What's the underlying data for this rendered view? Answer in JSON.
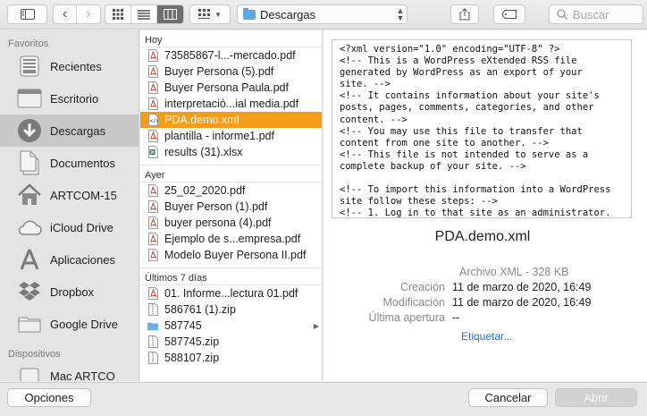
{
  "toolbar": {
    "location": "Descargas",
    "search_placeholder": "Buscar"
  },
  "sidebar": {
    "favorites_header": "Favoritos",
    "items": [
      {
        "label": "Recientes",
        "icon": "recents-icon"
      },
      {
        "label": "Escritorio",
        "icon": "desktop-icon"
      },
      {
        "label": "Descargas",
        "icon": "downloads-icon"
      },
      {
        "label": "Documentos",
        "icon": "documents-icon"
      },
      {
        "label": "ARTCOM-15",
        "icon": "home-icon"
      },
      {
        "label": "iCloud Drive",
        "icon": "cloud-icon"
      },
      {
        "label": "Aplicaciones",
        "icon": "applications-icon"
      },
      {
        "label": "Dropbox",
        "icon": "dropbox-icon"
      },
      {
        "label": "Google Drive",
        "icon": "folder-icon"
      }
    ],
    "devices_header": "Dispositivos",
    "device": "Mac ARTCO"
  },
  "files": {
    "today_header": "Hoy",
    "today": [
      {
        "name": "73585867-l...-mercado.pdf",
        "type": "pdf"
      },
      {
        "name": "Buyer Persona (5).pdf",
        "type": "pdf"
      },
      {
        "name": "Buyer Persona Paula.pdf",
        "type": "pdf"
      },
      {
        "name": "interpretació...ial media.pdf",
        "type": "pdf"
      },
      {
        "name": "PDA.demo.xml",
        "type": "xml"
      },
      {
        "name": "plantilla - informe1.pdf",
        "type": "pdf"
      },
      {
        "name": "results (31).xlsx",
        "type": "xlsx"
      }
    ],
    "yesterday_header": "Ayer",
    "yesterday": [
      {
        "name": "25_02_2020.pdf",
        "type": "pdf"
      },
      {
        "name": "Buyer Person (1).pdf",
        "type": "pdf"
      },
      {
        "name": "buyer persona (4).pdf",
        "type": "pdf"
      },
      {
        "name": "Ejemplo de s...empresa.pdf",
        "type": "pdf"
      },
      {
        "name": "Modelo Buyer Persona II.pdf",
        "type": "pdf"
      }
    ],
    "week_header": "Últimos 7 días",
    "week": [
      {
        "name": "01. Informe...lectura 01.pdf",
        "type": "pdf"
      },
      {
        "name": "586761 (1).zip",
        "type": "zip"
      },
      {
        "name": "587745",
        "type": "folder"
      },
      {
        "name": "587745.zip",
        "type": "zip"
      },
      {
        "name": "588107.zip",
        "type": "zip"
      }
    ]
  },
  "preview": {
    "code": "<?xml version=\"1.0\" encoding=\"UTF-8\" ?>\n<!-- This is a WordPress eXtended RSS file\ngenerated by WordPress as an export of your\nsite. -->\n<!-- It contains information about your site's\nposts, pages, comments, categories, and other\ncontent. -->\n<!-- You may use this file to transfer that\ncontent from one site to another. -->\n<!-- This file is not intended to serve as a\ncomplete backup of your site. -->\n\n<!-- To import this information into a WordPress\nsite follow these steps: -->\n<!-- 1. Log in to that site as an administrator.",
    "title": "PDA.demo.xml",
    "kind": "Archivo XML - 328 KB",
    "created_label": "Creación",
    "created": "11 de marzo de 2020, 16:49",
    "modified_label": "Modificación",
    "modified": "11 de marzo de 2020, 16:49",
    "opened_label": "Última apertura",
    "opened": "--",
    "tag_link": "Etiquetar..."
  },
  "bottom": {
    "options": "Opciones",
    "cancel": "Cancelar",
    "open": "Abrir"
  }
}
